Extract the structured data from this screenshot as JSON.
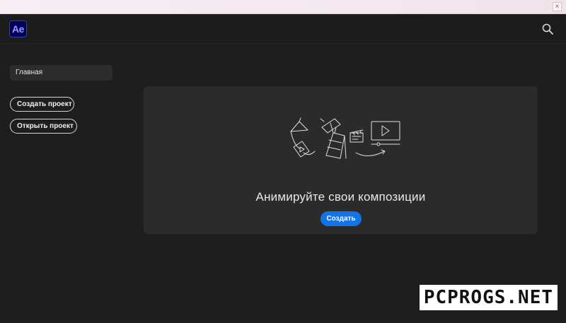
{
  "window": {
    "close_glyph": "×"
  },
  "appbar": {
    "logo_text": "Ae",
    "search_icon": "search-icon"
  },
  "sidebar": {
    "home_label": "Главная",
    "new_project_label": "Создать проект",
    "open_project_label": "Открыть проект"
  },
  "main": {
    "illustration_icon": "animation-illustration",
    "headline": "Анимируйте свои композиции",
    "create_label": "Создать"
  },
  "watermark": {
    "text": "PCPROGS.NET"
  },
  "colors": {
    "accent": "#1473e6",
    "logo_bg": "#00005b",
    "logo_fg": "#9999ff"
  }
}
